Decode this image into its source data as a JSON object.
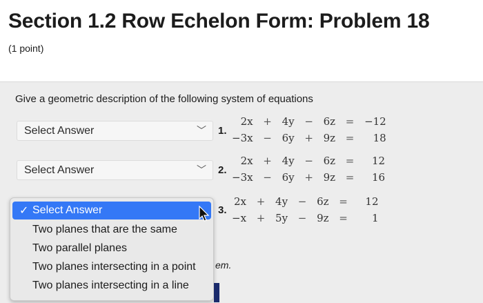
{
  "page": {
    "title": "Section 1.2 Row Echelon Form: Problem 18",
    "points": "(1 point)",
    "prompt": "Give a geometric description of the following system of equations"
  },
  "questions": [
    {
      "number": "1.",
      "select_value": "Select Answer",
      "rows": [
        {
          "a": "2x",
          "op1": "+",
          "b": "4y",
          "op2": "−",
          "c": "6z",
          "eq": "=",
          "rhs": "−12"
        },
        {
          "a": "−3x",
          "op1": "−",
          "b": "6y",
          "op2": "+",
          "c": "9z",
          "eq": "=",
          "rhs": "18"
        }
      ]
    },
    {
      "number": "2.",
      "select_value": "Select Answer",
      "rows": [
        {
          "a": "2x",
          "op1": "+",
          "b": "4y",
          "op2": "−",
          "c": "6z",
          "eq": "=",
          "rhs": "12"
        },
        {
          "a": "−3x",
          "op1": "−",
          "b": "6y",
          "op2": "+",
          "c": "9z",
          "eq": "=",
          "rhs": "16"
        }
      ]
    },
    {
      "number": "3.",
      "select_value": "Select Answer",
      "rows": [
        {
          "a": "2x",
          "op1": "+",
          "b": "4y",
          "op2": "−",
          "c": "6z",
          "eq": "=",
          "rhs": "12"
        },
        {
          "a": "−x",
          "op1": "+",
          "b": "5y",
          "op2": "−",
          "c": "9z",
          "eq": "=",
          "rhs": "1"
        }
      ]
    }
  ],
  "dropdown": {
    "check": "✓",
    "options": [
      "Select Answer",
      "Two planes that are the same",
      "Two parallel planes",
      "Two planes intersecting in a point",
      "Two planes intersecting in a line"
    ],
    "selected_index": 0
  },
  "footer_fragment": "em.",
  "colors": {
    "highlight": "#3478f6",
    "panel": "#ededed"
  }
}
